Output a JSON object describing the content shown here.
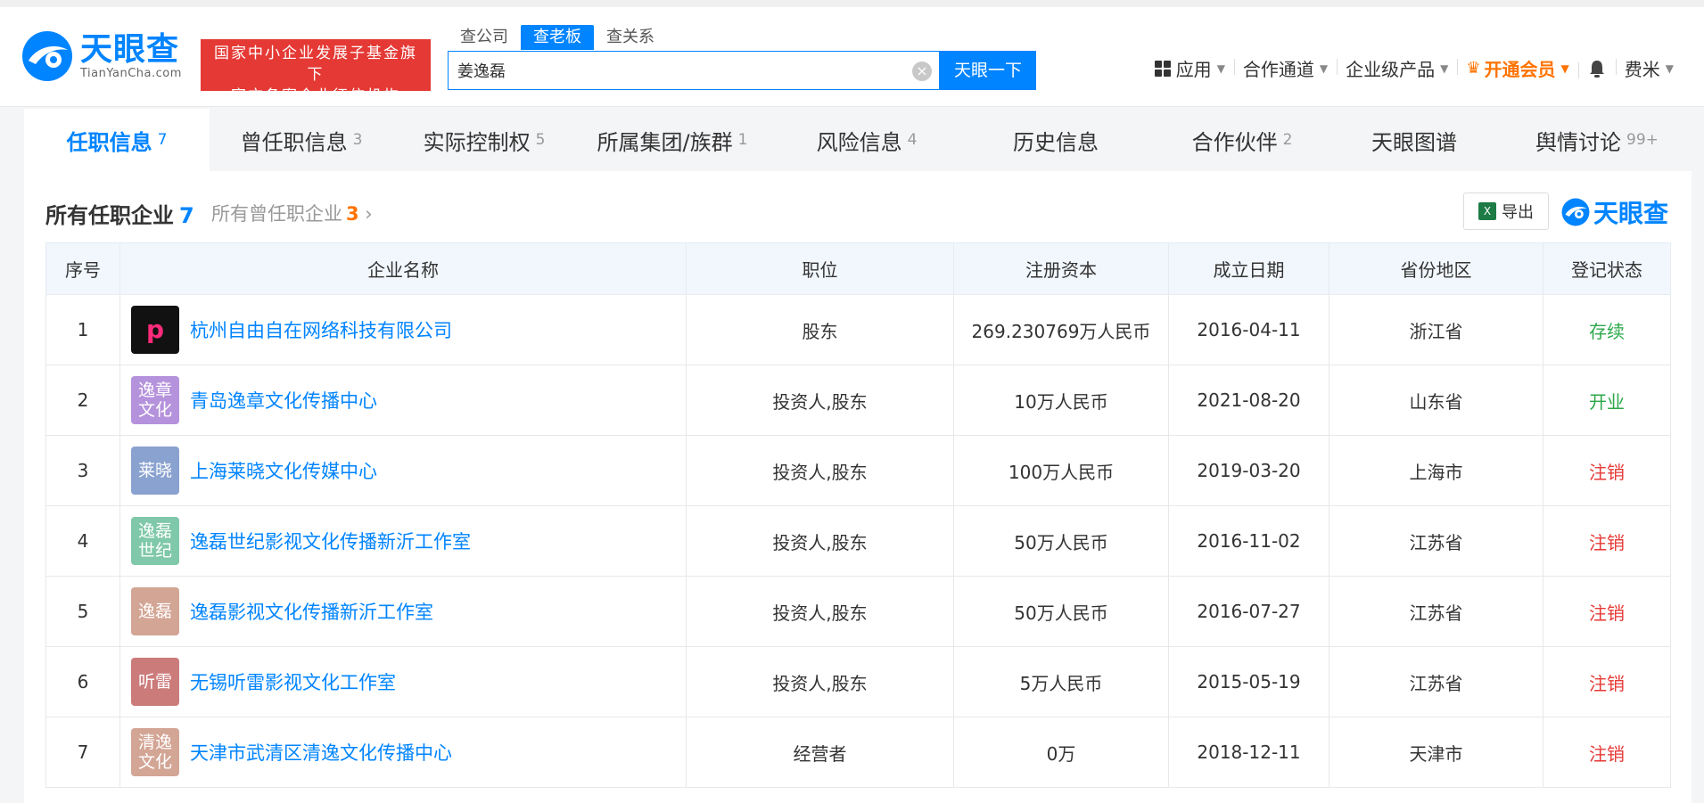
{
  "header": {
    "logo_cn": "天眼查",
    "logo_en": "TianYanCha.com",
    "badge_line1": "国家中小企业发展子基金旗下",
    "badge_line2": "官方备案企业征信机构",
    "search_tabs": [
      "查公司",
      "查老板",
      "查关系"
    ],
    "active_search_tab": "查老板",
    "search_value": "姜逸磊",
    "search_button": "天眼一下",
    "nav": {
      "apps": "应用",
      "channel": "合作通道",
      "enterprise": "企业级产品",
      "vip": "开通会员",
      "user": "费米"
    }
  },
  "tabs": [
    {
      "label": "任职信息",
      "count": "7"
    },
    {
      "label": "曾任职信息",
      "count": "3"
    },
    {
      "label": "实际控制权",
      "count": "5"
    },
    {
      "label": "所属集团/族群",
      "count": "1"
    },
    {
      "label": "风险信息",
      "count": "4"
    },
    {
      "label": "历史信息",
      "count": ""
    },
    {
      "label": "合作伙伴",
      "count": "2"
    },
    {
      "label": "天眼图谱",
      "count": ""
    },
    {
      "label": "舆情讨论",
      "count": "99+"
    }
  ],
  "section": {
    "title": "所有任职企业",
    "title_count": "7",
    "sub": "所有曾任职企业",
    "sub_count": "3",
    "export": "导出",
    "watermark": "天眼查"
  },
  "table": {
    "headers": [
      "序号",
      "企业名称",
      "职位",
      "注册资本",
      "成立日期",
      "省份地区",
      "登记状态"
    ],
    "rows": [
      {
        "no": "1",
        "logo_text": "p",
        "logo_color": "#111111",
        "name": "杭州自由自在网络科技有限公司",
        "position": "股东",
        "capital": "269.230769万人民币",
        "date": "2016-04-11",
        "region": "浙江省",
        "status": "存续",
        "status_color": "green"
      },
      {
        "no": "2",
        "logo_text": "逸章文化",
        "logo_color": "#b592dc",
        "name": "青岛逸章文化传播中心",
        "position": "投资人,股东",
        "capital": "10万人民币",
        "date": "2021-08-20",
        "region": "山东省",
        "status": "开业",
        "status_color": "green"
      },
      {
        "no": "3",
        "logo_text": "莱晓",
        "logo_color": "#8aa2cf",
        "name": "上海莱晓文化传媒中心",
        "position": "投资人,股东",
        "capital": "100万人民币",
        "date": "2019-03-20",
        "region": "上海市",
        "status": "注销",
        "status_color": "red"
      },
      {
        "no": "4",
        "logo_text": "逸磊世纪",
        "logo_color": "#7fc8a9",
        "name": "逸磊世纪影视文化传播新沂工作室",
        "position": "投资人,股东",
        "capital": "50万人民币",
        "date": "2016-11-02",
        "region": "江苏省",
        "status": "注销",
        "status_color": "red"
      },
      {
        "no": "5",
        "logo_text": "逸磊",
        "logo_color": "#d3a595",
        "name": "逸磊影视文化传播新沂工作室",
        "position": "投资人,股东",
        "capital": "50万人民币",
        "date": "2016-07-27",
        "region": "江苏省",
        "status": "注销",
        "status_color": "red"
      },
      {
        "no": "6",
        "logo_text": "听雷",
        "logo_color": "#cc7b7b",
        "name": "无锡听雷影视文化工作室",
        "position": "投资人,股东",
        "capital": "5万人民币",
        "date": "2015-05-19",
        "region": "江苏省",
        "status": "注销",
        "status_color": "red"
      },
      {
        "no": "7",
        "logo_text": "清逸文化",
        "logo_color": "#d3a595",
        "name": "天津市武清区清逸文化传播中心",
        "position": "经营者",
        "capital": "0万",
        "date": "2018-12-11",
        "region": "天津市",
        "status": "注销",
        "status_color": "red"
      }
    ]
  }
}
